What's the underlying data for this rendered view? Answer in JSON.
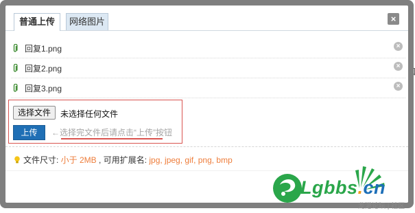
{
  "tabs": [
    {
      "label": "普通上传",
      "active": true
    },
    {
      "label": "网络图片",
      "active": false
    }
  ],
  "close_glyph": "×",
  "files": [
    {
      "name": "回复1.png"
    },
    {
      "name": "回复2.png"
    },
    {
      "name": "回复3.png"
    }
  ],
  "upload": {
    "choose_label": "选择文件",
    "no_file_text": "未选择任何文件",
    "upload_label": "上传",
    "hint": "←选择完文件后请点击“上传”按钮"
  },
  "info": {
    "size_label": "文件尺寸: ",
    "size_value": "小于 2MB",
    "ext_label": " , 可用扩展名: ",
    "ext_value": "jpg, jpeg, gif, png, bmp"
  },
  "watermark": {
    "brand_l": "Lgbbs",
    "brand_dot": ".",
    "brand_cn": "cn",
    "tagline": "龙港论坛 | 社区"
  },
  "background_fragments": {
    "left_char": "[",
    "right_char": "和"
  },
  "colors": {
    "accent_blue": "#1f6fb5",
    "highlight_red": "#d9534f",
    "orange_text": "#ee7d3b",
    "brand_green": "#2aa64a",
    "brand_blue": "#1d6fb8"
  },
  "icons": {
    "attachment": "paperclip-icon",
    "remove": "remove-circle-icon",
    "close": "close-icon",
    "tip": "lightbulb-icon"
  }
}
